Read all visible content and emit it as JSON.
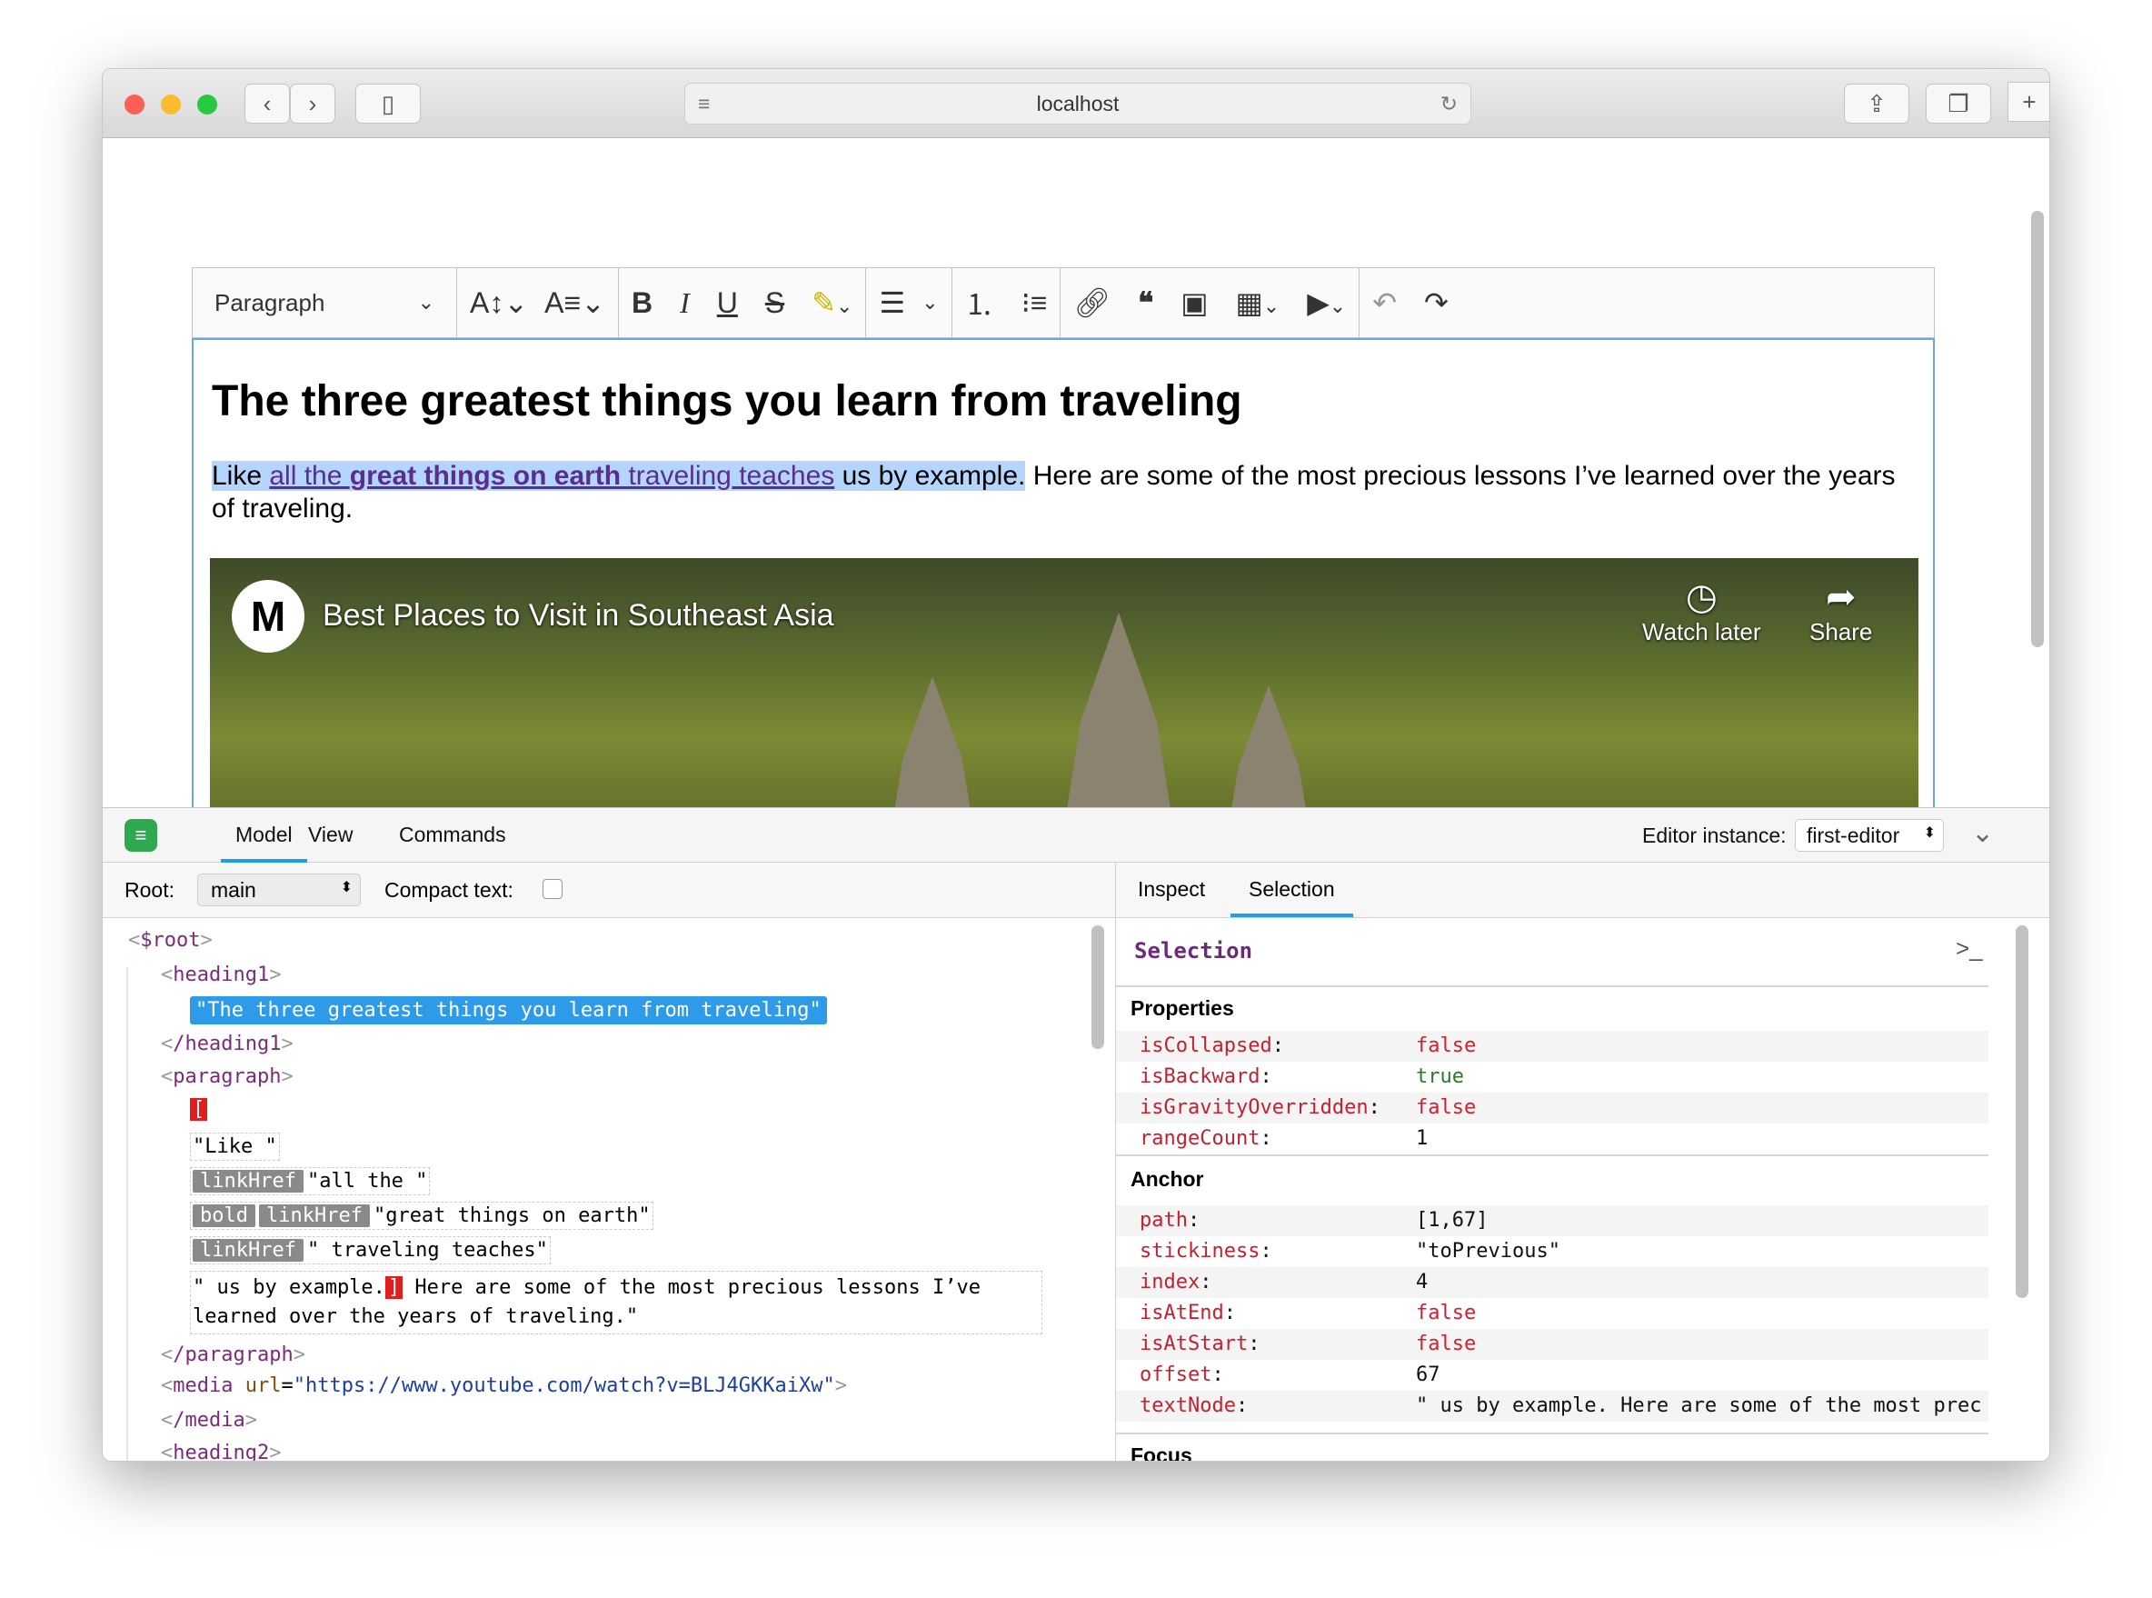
{
  "browser": {
    "url": "localhost"
  },
  "toolbar": {
    "heading_select": "Paragraph",
    "icons": [
      "font-size-icon",
      "font-family-icon",
      "bold-icon",
      "italic-icon",
      "underline-icon",
      "strikethrough-icon",
      "highlight-icon",
      "align-icon",
      "numbered-list-icon",
      "bulleted-list-icon",
      "link-icon",
      "blockquote-icon",
      "image-icon",
      "table-icon",
      "media-icon",
      "undo-icon",
      "redo-icon"
    ]
  },
  "editor": {
    "heading": "The three greatest things you learn from traveling",
    "p": {
      "t1": "Like ",
      "l1": "all the ",
      "l2": "great things on earth",
      "l3": " traveling teaches",
      "t2": " us by example.",
      "t3": " Here are some of the most precious lessons I’ve learned over the years of traveling."
    },
    "video": {
      "title": "Best Places to Visit in Southeast Asia",
      "watch_later": "Watch later",
      "share": "Share"
    }
  },
  "inspector": {
    "tabs": [
      "Model",
      "View",
      "Commands"
    ],
    "active_tab": "Model",
    "instance_label": "Editor instance:",
    "instance_value": "first-editor",
    "root_label": "Root:",
    "root_value": "main",
    "compact_label": "Compact text:",
    "compact_checked": false,
    "right_tabs": [
      "Inspect",
      "Selection"
    ],
    "right_active": "Selection",
    "tree": {
      "root": "$root",
      "h1": "heading1",
      "h1_text": "\"The three greatest things you learn from traveling\"",
      "h1_close": "/heading1",
      "p": "paragraph",
      "sel_start": "[",
      "t_like": "\"Like \"",
      "linkHref": "linkHref",
      "bold": "bold",
      "t_all": "\"all the \"",
      "t_great": "\"great things on earth\"",
      "t_trav": "\" traveling teaches\"",
      "t_us": "\" us by example.",
      "sel_end": "]",
      "t_here": " Here are some of the most precious lessons I’ve",
      "t_learned": "learned over the years of traveling.\"",
      "p_close": "/paragraph",
      "media": "media",
      "media_attr": "url",
      "media_url": "\"https://www.youtube.com/watch?v=BLJ4GKKaiXw\"",
      "media_close": "/media",
      "h2": "heading2"
    },
    "selection": {
      "title": "Selection",
      "properties_label": "Properties",
      "properties": [
        {
          "k": "isCollapsed",
          "v": "false",
          "c": "#d0202f"
        },
        {
          "k": "isBackward",
          "v": "true",
          "c": "#2a7a2a"
        },
        {
          "k": "isGravityOverridden",
          "v": "false",
          "c": "#d0202f"
        },
        {
          "k": "rangeCount",
          "v": "1",
          "c": "#111"
        }
      ],
      "anchor_label": "Anchor",
      "anchor": [
        {
          "k": "path",
          "v": "[1,67]",
          "c": "#111"
        },
        {
          "k": "stickiness",
          "v": "\"toPrevious\"",
          "c": "#111"
        },
        {
          "k": "index",
          "v": "4",
          "c": "#111"
        },
        {
          "k": "isAtEnd",
          "v": "false",
          "c": "#d0202f"
        },
        {
          "k": "isAtStart",
          "v": "false",
          "c": "#d0202f"
        },
        {
          "k": "offset",
          "v": "67",
          "c": "#111"
        },
        {
          "k": "textNode",
          "v": "\" us by example. Here are some of the most prec",
          "c": "#111"
        }
      ],
      "focus_label": "Focus"
    }
  }
}
